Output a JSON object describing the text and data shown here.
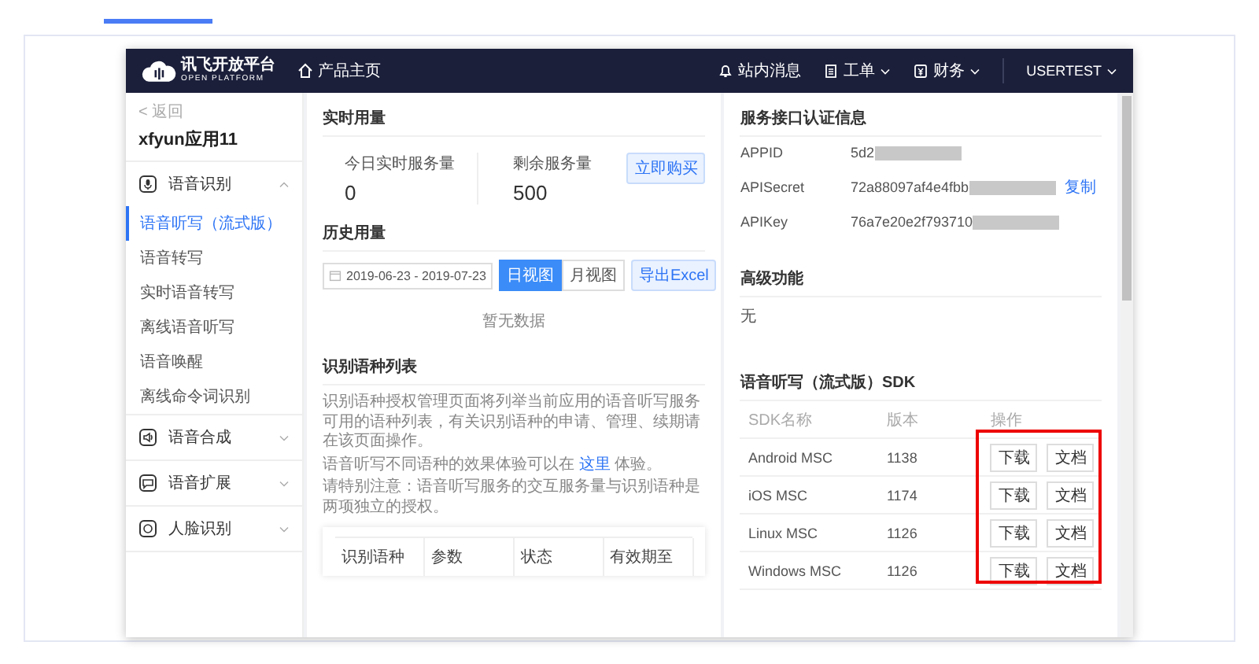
{
  "header": {
    "logo_title": "讯飞开放平台",
    "logo_subtitle": "OPEN PLATFORM",
    "home_link": "产品主页",
    "nav": [
      {
        "label": "站内消息",
        "kind": "bell",
        "dropdown": false
      },
      {
        "label": "工单",
        "kind": "ticket",
        "dropdown": true
      },
      {
        "label": "财务",
        "kind": "wallet",
        "dropdown": true
      }
    ],
    "user": "USERTEST"
  },
  "sidebar": {
    "back": "< 返回",
    "app_name": "xfyun应用11",
    "groups": [
      {
        "label": "语音识别",
        "kind": "mic",
        "expanded": true,
        "children": [
          {
            "label": "语音听写（流式版）",
            "selected": true
          },
          {
            "label": "语音转写",
            "selected": false
          },
          {
            "label": "实时语音转写",
            "selected": false
          },
          {
            "label": "离线语音听写",
            "selected": false
          },
          {
            "label": "语音唤醒",
            "selected": false
          },
          {
            "label": "离线命令词识别",
            "selected": false
          }
        ]
      },
      {
        "label": "语音合成",
        "kind": "speaker",
        "expanded": false
      },
      {
        "label": "语音扩展",
        "kind": "chat",
        "expanded": false
      },
      {
        "label": "人脸识别",
        "kind": "face",
        "expanded": false
      }
    ]
  },
  "realtime": {
    "title": "实时用量",
    "stats": [
      {
        "label": "今日实时服务量",
        "value": "0"
      },
      {
        "label": "剩余服务量",
        "value": "500"
      }
    ],
    "buy_button": "立即购买"
  },
  "history": {
    "title": "历史用量",
    "date_range": "2019-06-23 - 2019-07-23",
    "view_tabs": [
      {
        "label": "日视图",
        "selected": true
      },
      {
        "label": "月视图",
        "selected": false
      }
    ],
    "export_button": "导出Excel",
    "empty_text": "暂无数据"
  },
  "languages": {
    "title": "识别语种列表",
    "paragraphs": [
      {
        "text": "识别语种授权管理页面将列举当前应用的语音听写服务可用的语种列表，有关识别语种的申请、管理、续期请在该页面操作。"
      },
      {
        "text": "语音听写不同语种的效果体验可以在 ",
        "link": "这里",
        "after": " 体验。"
      },
      {
        "text": "请特别注意：语音听写服务的交互服务量与识别语种是两项独立的授权。"
      }
    ],
    "columns": [
      "识别语种",
      "参数",
      "状态",
      "有效期至"
    ]
  },
  "auth": {
    "title": "服务接口认证信息",
    "fields": [
      {
        "label": "APPID",
        "value": "5d2",
        "redacted": true
      },
      {
        "label": "APISecret",
        "value": "72a88097af4e4fbb",
        "redacted": true,
        "action": "复制"
      },
      {
        "label": "APIKey",
        "value": "76a7e20e2f793710",
        "redacted": true
      }
    ]
  },
  "advanced": {
    "title": "高级功能",
    "value": "无"
  },
  "sdk": {
    "title": "语音听写（流式版）SDK",
    "columns": [
      "SDK名称",
      "版本",
      "操作"
    ],
    "highlight_actions": true,
    "rows": [
      {
        "name": "Android MSC",
        "version": "1138",
        "actions": [
          "下载",
          "文档"
        ]
      },
      {
        "name": "iOS MSC",
        "version": "1174",
        "actions": [
          "下载",
          "文档"
        ]
      },
      {
        "name": "Linux MSC",
        "version": "1126",
        "actions": [
          "下载",
          "文档"
        ]
      },
      {
        "name": "Windows MSC",
        "version": "1126",
        "actions": [
          "下载",
          "文档"
        ]
      }
    ]
  }
}
